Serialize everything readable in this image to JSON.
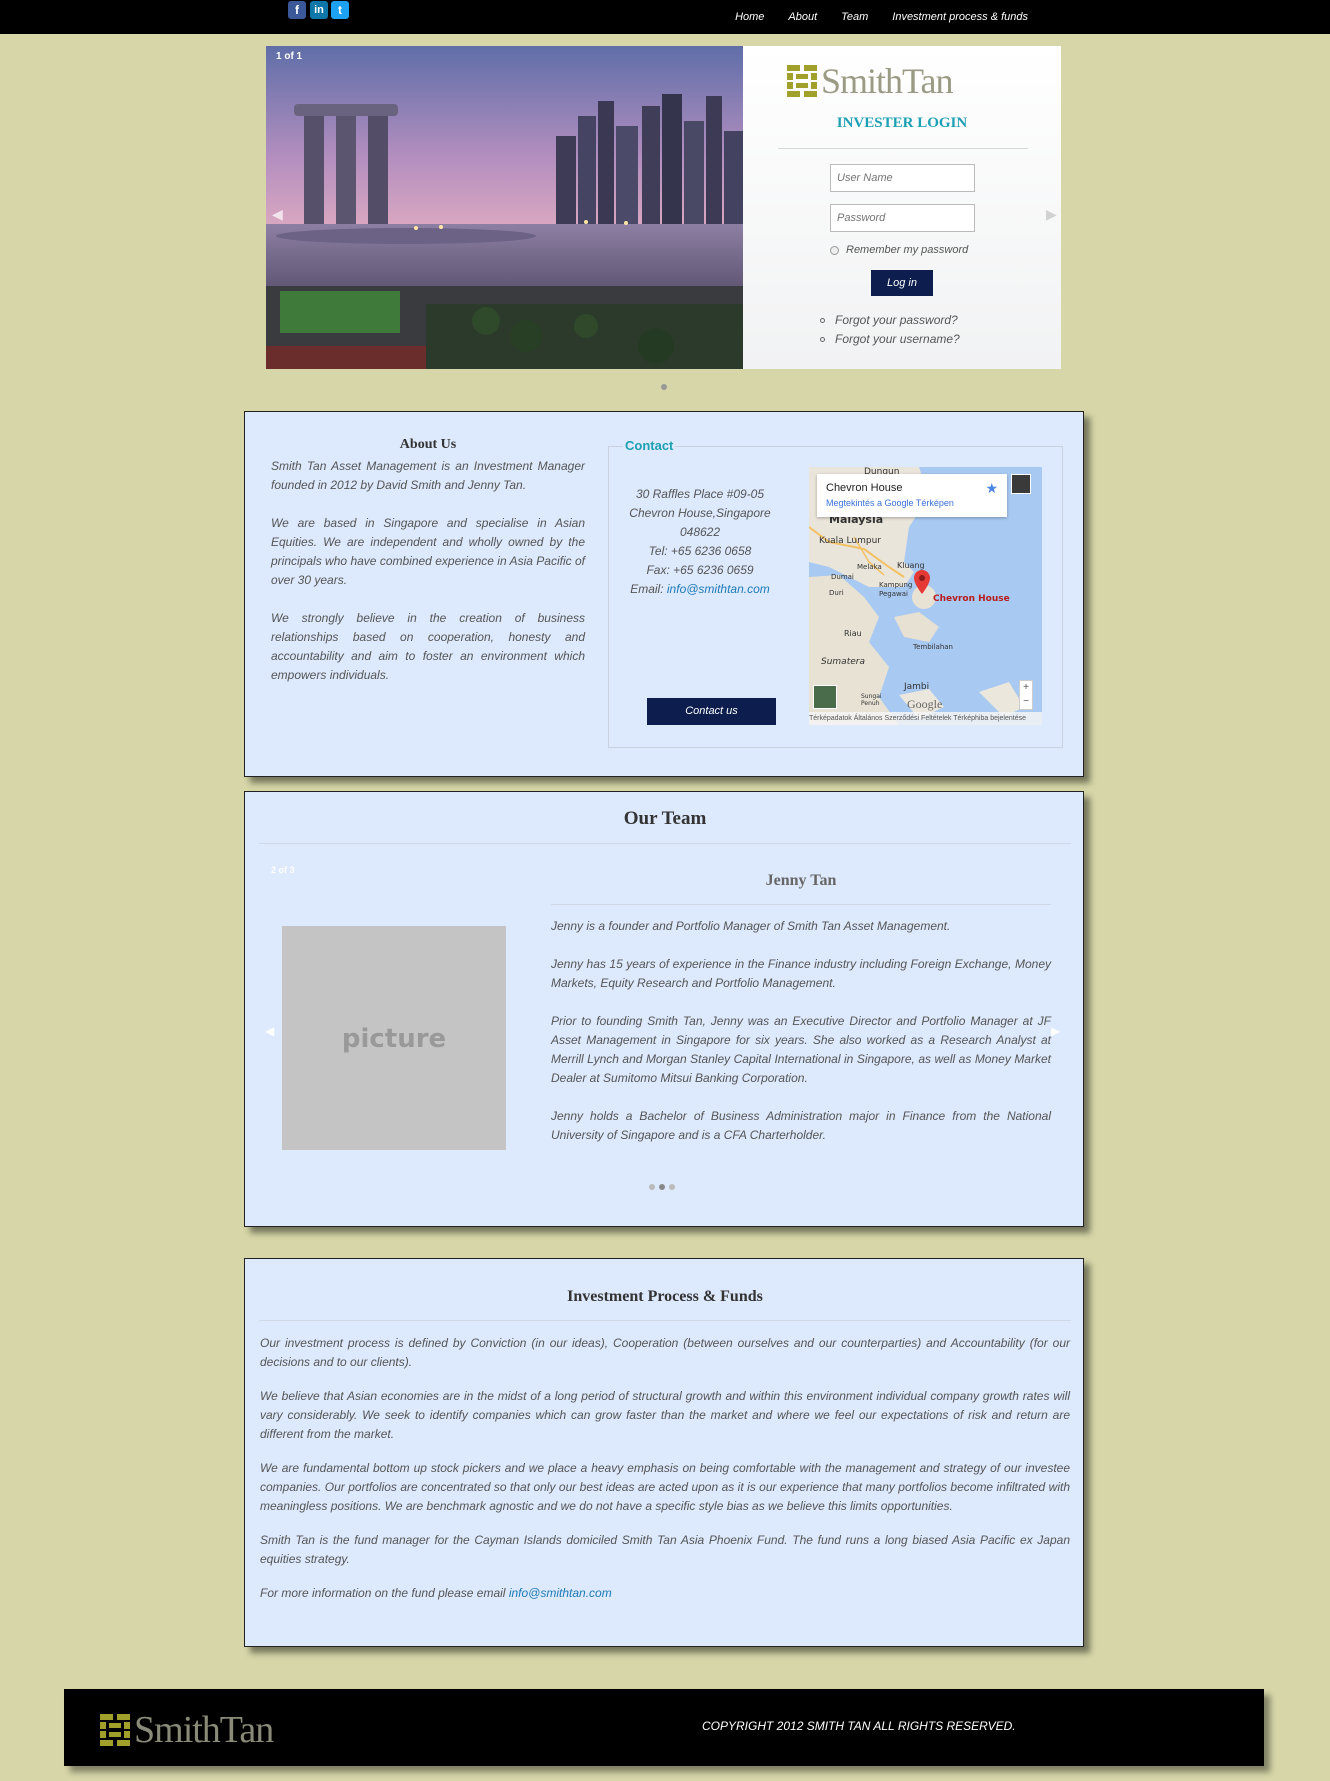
{
  "nav": {
    "social": {
      "facebook": "f",
      "linkedin": "in",
      "twitter": "t"
    },
    "links": [
      "Home",
      "About",
      "Team",
      "Investment process & funds"
    ]
  },
  "hero": {
    "counter": "1 of 1",
    "logo_text": "SmithTan",
    "login_title": "INVESTER LOGIN",
    "username_placeholder": "User Name",
    "password_placeholder": "Password",
    "remember_label": "Remember my password",
    "login_button": "Log in",
    "forgot_password": "Forgot your password?",
    "forgot_username": "Forgot your username?"
  },
  "about": {
    "title": "About Us",
    "paragraphs": [
      "Smith Tan Asset Management is an Investment Manager founded in 2012 by David Smith and Jenny Tan.",
      "We are based in Singapore and specialise in Asian Equities. We are independent and wholly owned by the principals who have combined experience in Asia Pacific of over 30 years.",
      "We strongly believe in the creation of business relationships based on cooperation, honesty and accountability and aim to foster an environment which empowers individuals."
    ]
  },
  "contact": {
    "legend": "Contact",
    "address1": "30 Raffles Place #09-05",
    "address2": "Chevron House,Singapore",
    "postcode": "048622",
    "tel": "Tel: +65 6236 0658",
    "fax": "Fax: +65 6236 0659",
    "email_label": "Email:",
    "email": "info@smithtan.com",
    "button": "Contact us",
    "map": {
      "card_title": "Chevron House",
      "card_link": "Megtekintés a Google Térképen",
      "pin_label": "Chevron House",
      "footer": "Térképadatok   Általános Szerződési Feltételek   Térképhiba bejelentése",
      "brand": "Google",
      "places": [
        "Dungun",
        "Malaysia",
        "Kuala Lumpur",
        "Melaka",
        "Kluang",
        "Dumai",
        "Kampung Pegawai",
        "Duri",
        "Riau",
        "Tembilahan",
        "Sumatera",
        "Jambi",
        "Sungai Penuh"
      ]
    }
  },
  "team": {
    "title": "Our Team",
    "counter": "2 of 3",
    "picture_label": "picture",
    "member_name": "Jenny Tan",
    "bio": [
      "Jenny is a founder and Portfolio Manager of Smith Tan Asset Management.",
      "Jenny has 15 years of experience in the Finance industry including Foreign Exchange, Money Markets, Equity Research and Portfolio Management.",
      "Prior to founding Smith Tan, Jenny was an Executive Director and Portfolio Manager at JF Asset Management in Singapore for six years. She also worked as a Research Analyst at Merrill Lynch and Morgan Stanley Capital International in Singapore, as well as Money Market Dealer at Sumitomo Mitsui Banking Corporation.",
      "Jenny holds a Bachelor of Business Administration major in Finance from the National University of Singapore and is a CFA Charterholder."
    ]
  },
  "invest": {
    "title": "Investment Process & Funds",
    "paragraphs": [
      "Our investment process is defined by Conviction (in our ideas), Cooperation (between ourselves and our counterparties) and Accountability (for our decisions and to our clients).",
      "We believe that Asian economies are in the midst of a long period of structural growth and within this environment individual company growth rates will vary considerably. We seek to identify companies which can grow faster than the market and where we feel our expectations of risk and return are different from the market.",
      "We are fundamental bottom up stock pickers and we place a heavy emphasis on being comfortable with the management and strategy of our investee companies. Our portfolios are concentrated so that only our best ideas are acted upon as it is our experience that many portfolios become infiltrated with meaningless positions. We are benchmark agnostic and we do not have a specific style bias as we believe this limits opportunities.",
      "Smith Tan is the fund manager for the Cayman Islands domiciled Smith Tan Asia Phoenix Fund. The fund runs a long biased Asia Pacific ex Japan equities strategy."
    ],
    "fund_info_prefix": "For more information on the fund please email",
    "fund_email": "info@smithtan.com"
  },
  "footer": {
    "logo_text": "SmithTan",
    "copyright": "COPYRIGHT 2012 SMITH TAN ALL RIGHTS RESERVED."
  },
  "colors": {
    "page_bg": "#d6d6a8",
    "panel_bg": "#dde9fc",
    "navy": "#0d1e4e",
    "teal": "#1ea0b4",
    "logo_olive": "#a0a02a"
  }
}
